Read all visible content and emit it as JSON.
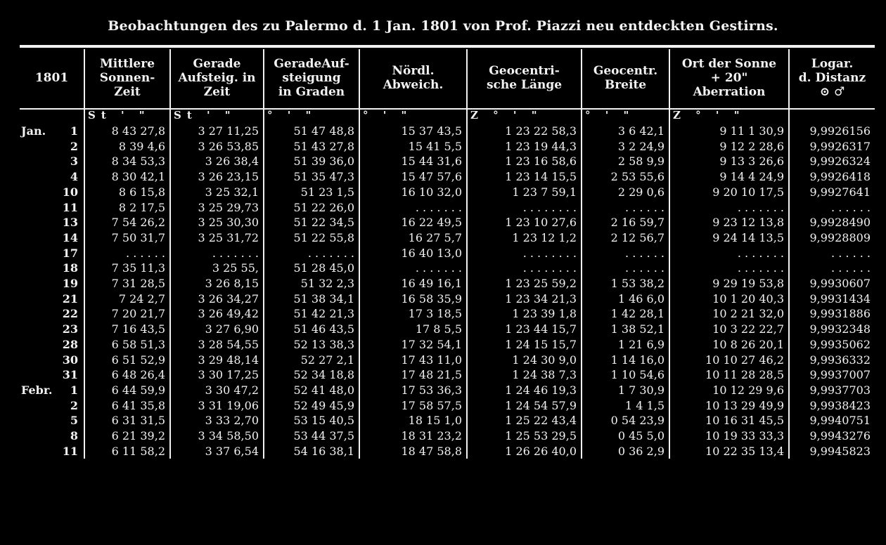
{
  "title": "Beobachtungen des zu Palermo d. 1 Jan. 1801 von Prof. Piazzi neu entdeckten Gestirns.",
  "headers": [
    [
      "1801"
    ],
    [
      "Mittlere",
      "Sonnen-",
      "Zeit"
    ],
    [
      "Gerade",
      "Aufsteig. in",
      "Zeit"
    ],
    [
      "GeradeAuf-",
      "steigung",
      "in Graden"
    ],
    [
      "Nördl.",
      "Abweich."
    ],
    [
      "Geocentri-",
      "sche Länge"
    ],
    [
      "Geocentr.",
      "Breite"
    ],
    [
      "Ort der Sonne",
      "+ 20\"",
      "Aberration"
    ],
    [
      "Logar.",
      "d. Distanz",
      "⊙ ♂"
    ]
  ],
  "units": [
    "",
    "St  '  \"",
    "St  '  \"",
    "°  '  \"",
    "°  '  \"",
    "Z °  '  \"",
    "°  '  \"",
    "Z °  '  \"",
    ""
  ],
  "rows": [
    {
      "month": "Jan.",
      "day": "1",
      "cells": [
        "8 43 27,8",
        "3 27 11,25",
        "51 47 48,8",
        "15 37 43,5",
        "1 23 22 58,3",
        "3 6 42,1",
        "9 11 1 30,9",
        "9,9926156"
      ]
    },
    {
      "month": "",
      "day": "2",
      "cells": [
        "8 39 4,6",
        "3 26 53,85",
        "51 43 27,8",
        "15 41 5,5",
        "1 23 19 44,3",
        "3 2 24,9",
        "9 12 2 28,6",
        "9,9926317"
      ]
    },
    {
      "month": "",
      "day": "3",
      "cells": [
        "8 34 53,3",
        "3 26 38,4",
        "51 39 36,0",
        "15 44 31,6",
        "1 23 16 58,6",
        "2 58 9,9",
        "9 13 3 26,6",
        "9,9926324"
      ]
    },
    {
      "month": "",
      "day": "4",
      "cells": [
        "8 30 42,1",
        "3 26 23,15",
        "51 35 47,3",
        "15 47 57,6",
        "1 23 14 15,5",
        "2 53 55,6",
        "9 14 4 24,9",
        "9,9926418"
      ]
    },
    {
      "month": "",
      "day": "10",
      "cells": [
        "8 6 15,8",
        "3 25 32,1",
        "51 23 1,5",
        "16 10 32,0",
        "1 23 7 59,1",
        "2 29 0,6",
        "9 20 10 17,5",
        "9,9927641"
      ]
    },
    {
      "month": "",
      "day": "11",
      "cells": [
        "8 2 17,5",
        "3 25 29,73",
        "51 22 26,0",
        ". . . . . . .",
        ". . . . . . . .",
        ". . . . . .",
        ". . . . . . .",
        ". . . . . ."
      ]
    },
    {
      "month": "",
      "day": "13",
      "cells": [
        "7 54 26,2",
        "3 25 30,30",
        "51 22 34,5",
        "16 22 49,5",
        "1 23 10 27,6",
        "2 16 59,7",
        "9 23 12 13,8",
        "9,9928490"
      ]
    },
    {
      "month": "",
      "day": "14",
      "cells": [
        "7 50 31,7",
        "3 25 31,72",
        "51 22 55,8",
        "16 27 5,7",
        "1 23 12 1,2",
        "2 12 56,7",
        "9 24 14 13,5",
        "9,9928809"
      ]
    },
    {
      "month": "",
      "day": "17",
      "cells": [
        ". . . . . .",
        ". . . . . . .",
        ". . . . . . .",
        "16 40 13,0",
        ". . . . . . . .",
        ". . . . . .",
        ". . . . . . .",
        ". . . . . ."
      ]
    },
    {
      "month": "",
      "day": "18",
      "cells": [
        "7 35 11,3",
        "3 25 55,",
        "51 28 45,0",
        ". . . . . . .",
        ". . . . . . . .",
        ". . . . . .",
        ". . . . . . .",
        ". . . . . ."
      ]
    },
    {
      "month": "",
      "day": "19",
      "cells": [
        "7 31 28,5",
        "3 26 8,15",
        "51 32 2,3",
        "16 49 16,1",
        "1 23 25 59,2",
        "1 53 38,2",
        "9 29 19 53,8",
        "9,9930607"
      ]
    },
    {
      "month": "",
      "day": "21",
      "cells": [
        "7 24 2,7",
        "3 26 34,27",
        "51 38 34,1",
        "16 58 35,9",
        "1 23 34 21,3",
        "1 46 6,0",
        "10 1 20 40,3",
        "9,9931434"
      ]
    },
    {
      "month": "",
      "day": "22",
      "cells": [
        "7 20 21,7",
        "3 26 49,42",
        "51 42 21,3",
        "17 3 18,5",
        "1 23 39 1,8",
        "1 42 28,1",
        "10 2 21 32,0",
        "9,9931886"
      ]
    },
    {
      "month": "",
      "day": "23",
      "cells": [
        "7 16 43,5",
        "3 27 6,90",
        "51 46 43,5",
        "17 8 5,5",
        "1 23 44 15,7",
        "1 38 52,1",
        "10 3 22 22,7",
        "9,9932348"
      ]
    },
    {
      "month": "",
      "day": "28",
      "cells": [
        "6 58 51,3",
        "3 28 54,55",
        "52 13 38,3",
        "17 32 54,1",
        "1 24 15 15,7",
        "1 21 6,9",
        "10 8 26 20,1",
        "9,9935062"
      ]
    },
    {
      "month": "",
      "day": "30",
      "cells": [
        "6 51 52,9",
        "3 29 48,14",
        "52 27 2,1",
        "17 43 11,0",
        "1 24 30 9,0",
        "1 14 16,0",
        "10 10 27 46,2",
        "9,9936332"
      ]
    },
    {
      "month": "",
      "day": "31",
      "cells": [
        "6 48 26,4",
        "3 30 17,25",
        "52 34 18,8",
        "17 48 21,5",
        "1 24 38 7,3",
        "1 10 54,6",
        "10 11 28 28,5",
        "9,9937007"
      ]
    },
    {
      "month": "Febr.",
      "day": "1",
      "cells": [
        "6 44 59,9",
        "3 30 47,2",
        "52 41 48,0",
        "17 53 36,3",
        "1 24 46 19,3",
        "1 7 30,9",
        "10 12 29 9,6",
        "9,9937703"
      ]
    },
    {
      "month": "",
      "day": "2",
      "cells": [
        "6 41 35,8",
        "3 31 19,06",
        "52 49 45,9",
        "17 58 57,5",
        "1 24 54 57,9",
        "1 4 1,5",
        "10 13 29 49,9",
        "9,9938423"
      ]
    },
    {
      "month": "",
      "day": "5",
      "cells": [
        "6 31 31,5",
        "3 33 2,70",
        "53 15 40,5",
        "18 15 1,0",
        "1 25 22 43,4",
        "0 54 23,9",
        "10 16 31 45,5",
        "9,9940751"
      ]
    },
    {
      "month": "",
      "day": "8",
      "cells": [
        "6 21 39,2",
        "3 34 58,50",
        "53 44 37,5",
        "18 31 23,2",
        "1 25 53 29,5",
        "0 45 5,0",
        "10 19 33 33,3",
        "9,9943276"
      ]
    },
    {
      "month": "",
      "day": "11",
      "cells": [
        "6 11 58,2",
        "3 37 6,54",
        "54 16 38,1",
        "18 47 58,8",
        "1 26 26 40,0",
        "0 36 2,9",
        "10 22 35 13,4",
        "9,9945823"
      ]
    }
  ]
}
